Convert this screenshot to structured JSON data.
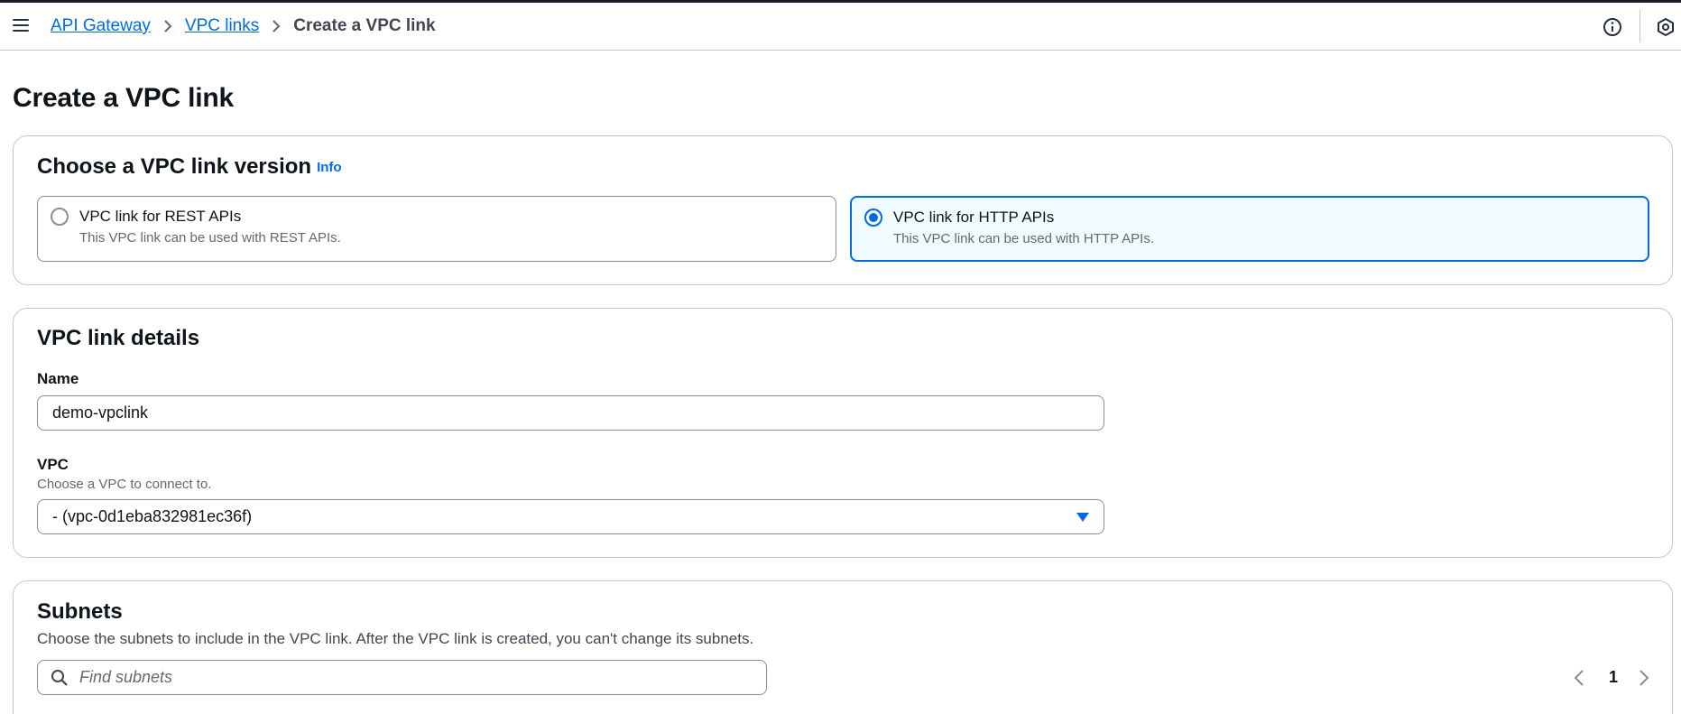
{
  "breadcrumb": {
    "items": [
      {
        "label": "API Gateway"
      },
      {
        "label": "VPC links"
      },
      {
        "label": "Create a VPC link"
      }
    ]
  },
  "page": {
    "title": "Create a VPC link"
  },
  "version_section": {
    "title": "Choose a VPC link version",
    "info_label": "Info",
    "options": [
      {
        "label": "VPC link for REST APIs",
        "description": "This VPC link can be used with REST APIs.",
        "selected": false
      },
      {
        "label": "VPC link for HTTP APIs",
        "description": "This VPC link can be used with HTTP APIs.",
        "selected": true
      }
    ]
  },
  "details_section": {
    "title": "VPC link details",
    "name_label": "Name",
    "name_value": "demo-vpclink",
    "vpc_label": "VPC",
    "vpc_description": "Choose a VPC to connect to.",
    "vpc_value": "- (vpc-0d1eba832981ec36f)"
  },
  "subnets_section": {
    "title": "Subnets",
    "description": "Choose the subnets to include in the VPC link. After the VPC link is created, you can't change its subnets.",
    "search_placeholder": "Find subnets",
    "current_page": "1"
  },
  "icons": {
    "menu": "hamburger-menu-icon",
    "info": "info-circle-icon",
    "settings": "hexagon-settings-icon",
    "search": "search-icon",
    "select": "caret-down-icon",
    "prev": "chevron-left-icon",
    "next": "chevron-right-icon"
  },
  "colors": {
    "link": "#006ce0",
    "selected_tile_bg": "#f0fbff",
    "border": "#8c8c94",
    "header_dark": "#161d26"
  }
}
